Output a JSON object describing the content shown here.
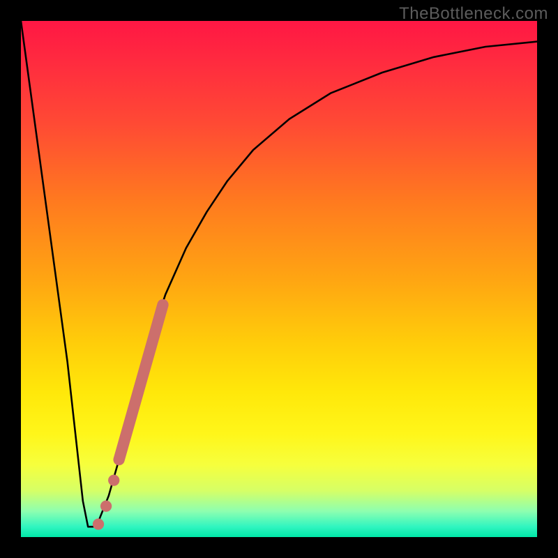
{
  "watermark": "TheBottleneck.com",
  "colors": {
    "frame": "#000000",
    "curve": "#000000",
    "marker": "#cc6f6c",
    "gradient_stops": [
      {
        "offset": 0.0,
        "color": "#ff1744"
      },
      {
        "offset": 0.08,
        "color": "#ff2b3f"
      },
      {
        "offset": 0.2,
        "color": "#ff4a34"
      },
      {
        "offset": 0.35,
        "color": "#ff7a1f"
      },
      {
        "offset": 0.5,
        "color": "#ffa512"
      },
      {
        "offset": 0.62,
        "color": "#ffcc0a"
      },
      {
        "offset": 0.72,
        "color": "#ffe80a"
      },
      {
        "offset": 0.8,
        "color": "#fff61a"
      },
      {
        "offset": 0.86,
        "color": "#f6ff3d"
      },
      {
        "offset": 0.91,
        "color": "#d6ff66"
      },
      {
        "offset": 0.95,
        "color": "#8dffb0"
      },
      {
        "offset": 0.98,
        "color": "#30f5c0"
      },
      {
        "offset": 1.0,
        "color": "#00e8a8"
      }
    ]
  },
  "chart_data": {
    "type": "line",
    "title": "",
    "xlabel": "",
    "ylabel": "",
    "xlim": [
      0,
      100
    ],
    "ylim": [
      0,
      100
    ],
    "series": [
      {
        "name": "bottleneck-curve",
        "x": [
          0,
          3,
          6,
          9,
          11,
          12,
          13,
          14,
          15,
          17,
          19,
          21,
          23,
          25,
          28,
          32,
          36,
          40,
          45,
          52,
          60,
          70,
          80,
          90,
          100
        ],
        "y": [
          100,
          78,
          56,
          34,
          16,
          7,
          2,
          2,
          3,
          8,
          15,
          23,
          31,
          38,
          47,
          56,
          63,
          69,
          75,
          81,
          86,
          90,
          93,
          95,
          96
        ]
      }
    ],
    "markers": {
      "name": "highlight-segment",
      "color": "#cc6f6c",
      "points": [
        {
          "x": 15.0,
          "y": 2.5,
          "r": 1.1
        },
        {
          "x": 16.5,
          "y": 6.0,
          "r": 1.1
        },
        {
          "x": 18.0,
          "y": 11.0,
          "r": 1.1
        }
      ],
      "thick_segment": {
        "x0": 19.0,
        "y0": 15.0,
        "x1": 27.5,
        "y1": 45.0,
        "width": 2.2
      }
    }
  }
}
